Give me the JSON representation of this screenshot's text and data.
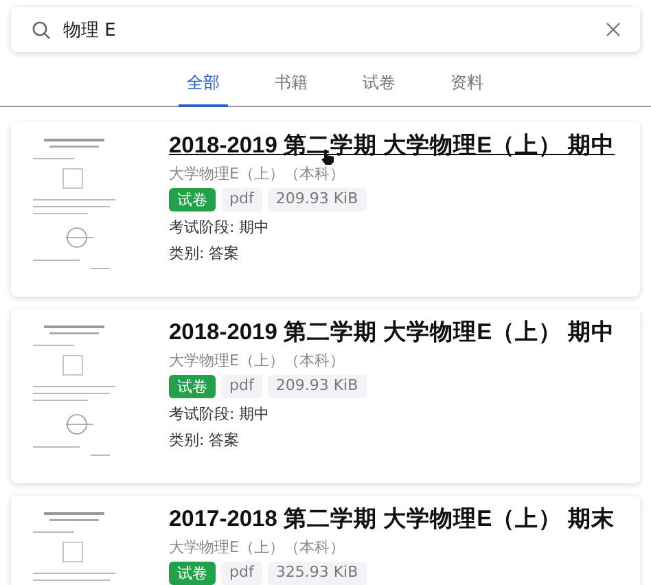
{
  "search": {
    "value": "物理 E"
  },
  "tabs": [
    {
      "label": "全部",
      "selected": true
    },
    {
      "label": "书籍",
      "selected": false
    },
    {
      "label": "试卷",
      "selected": false
    },
    {
      "label": "资料",
      "selected": false
    }
  ],
  "results": [
    {
      "title": "2018-2019 第二学期 大学物理E（上） 期中",
      "hovered": true,
      "subtitle": "大学物理E（上）（本科）",
      "thumbnail": {
        "kind": "picture"
      },
      "tags": [
        {
          "kind": "type",
          "label": "试卷"
        },
        {
          "kind": "plain",
          "label": "pdf"
        },
        {
          "kind": "plain",
          "label": "209.93 KiB"
        }
      ],
      "meta": [
        "考试阶段: 期中",
        "类别: 答案"
      ]
    },
    {
      "title": "2018-2019 第二学期 大学物理E（上） 期中",
      "hovered": false,
      "subtitle": "大学物理E（上）（本科）",
      "thumbnail": {
        "kind": "picture"
      },
      "tags": [
        {
          "kind": "type",
          "label": "试卷"
        },
        {
          "kind": "plain",
          "label": "pdf"
        },
        {
          "kind": "plain",
          "label": "209.93 KiB"
        }
      ],
      "meta": [
        "考试阶段: 期中",
        "类别: 答案"
      ]
    },
    {
      "title": "2017-2018 第二学期 大学物理E（上） 期末",
      "hovered": false,
      "subtitle": "大学物理E（上）（本科）",
      "thumbnail": {
        "kind": "picture"
      },
      "tags": [
        {
          "kind": "type",
          "label": "试卷"
        },
        {
          "kind": "plain",
          "label": "pdf"
        },
        {
          "kind": "plain",
          "label": "325.93 KiB"
        }
      ]
    }
  ]
}
